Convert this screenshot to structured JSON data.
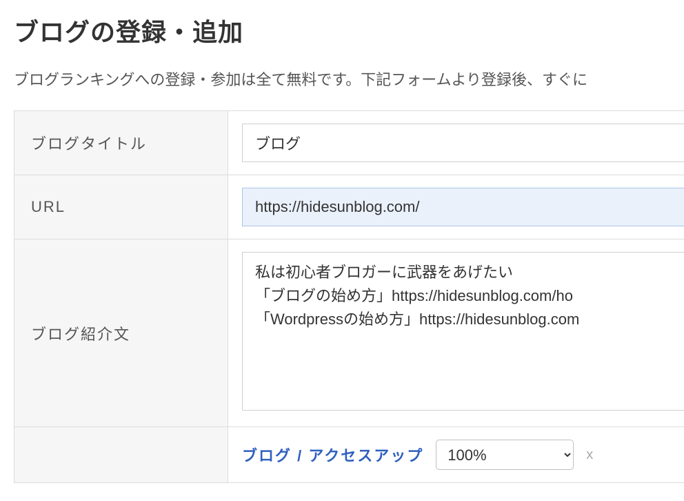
{
  "page": {
    "title": "ブログの登録・追加",
    "description": "ブログランキングへの登録・参加は全て無料です。下記フォームより登録後、すぐに"
  },
  "form": {
    "blog_title": {
      "label": "ブログタイトル",
      "value": "ブログ"
    },
    "url": {
      "label": "URL",
      "value": "https://hidesunblog.com/"
    },
    "intro": {
      "label": "ブログ紹介文",
      "value": "私は初心者ブロガーに武器をあげたい\n「ブログの始め方」https://hidesunblog.com/ho\n「Wordpressの始め方」https://hidesunblog.com"
    },
    "category": {
      "label": "ブログ / アクセスアップ",
      "percent_value": "100%",
      "remove_label": "x"
    }
  }
}
